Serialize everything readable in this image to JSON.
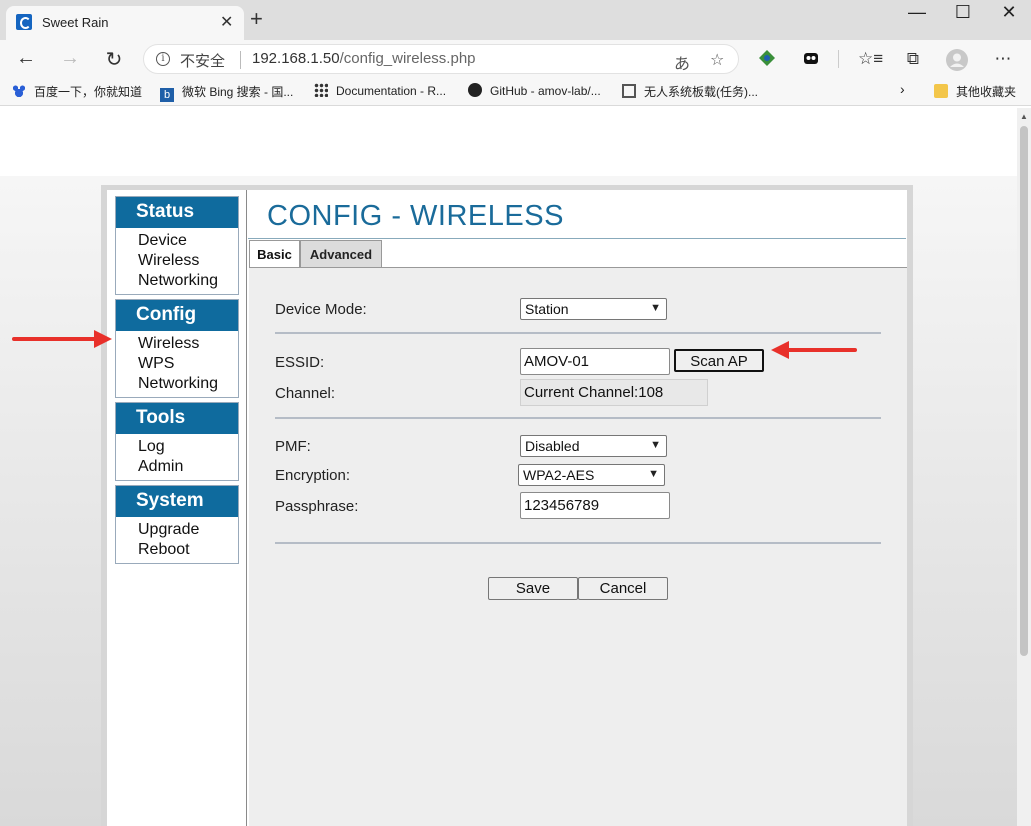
{
  "browser": {
    "tab_title": "Sweet Rain",
    "tab_close": "✕",
    "new_tab": "+",
    "window_controls": {
      "minimize": "—",
      "maximize": "☐",
      "close": "✕"
    },
    "address": {
      "security_label": "不安全",
      "host": "192.168.1.50",
      "path": "/config_wireless.php"
    },
    "bookmarks": [
      "百度一下，你就知道",
      "微软 Bing 搜索 - 国...",
      "Documentation - R...",
      "GitHub - amov-lab/...",
      "无人系统板载(任务)...",
      "其他收藏夹"
    ],
    "icons": [
      "back-icon",
      "forward-icon",
      "refresh-icon",
      "info-icon",
      "translate-icon",
      "star-icon",
      "extension-icon",
      "collections-icon",
      "favorites-icon",
      "profile-icon",
      "more-icon"
    ]
  },
  "page": {
    "title": "CONFIG - WIRELESS",
    "menu": [
      {
        "heading": "Status",
        "items": [
          "Device",
          "Wireless",
          "Networking"
        ]
      },
      {
        "heading": "Config",
        "items": [
          "Wireless",
          "WPS",
          "Networking"
        ]
      },
      {
        "heading": "Tools",
        "items": [
          "Log",
          "Admin"
        ]
      },
      {
        "heading": "System",
        "items": [
          "Upgrade",
          "Reboot"
        ]
      }
    ],
    "tabs": {
      "basic": "Basic",
      "advanced": "Advanced"
    },
    "form": {
      "device_mode_label": "Device Mode:",
      "device_mode_value": "Station",
      "essid_label": "ESSID:",
      "essid_value": "AMOV-01",
      "scan_label": "Scan AP",
      "channel_label": "Channel:",
      "channel_value": "Current Channel:108",
      "pmf_label": "PMF:",
      "pmf_value": "Disabled",
      "encryption_label": "Encryption:",
      "encryption_value": "WPA2-AES",
      "passphrase_label": "Passphrase:",
      "passphrase_value": "123456789",
      "save_label": "Save",
      "cancel_label": "Cancel"
    },
    "colors": {
      "accent": "#0f6b9e",
      "arrow": "#e8302a"
    }
  }
}
